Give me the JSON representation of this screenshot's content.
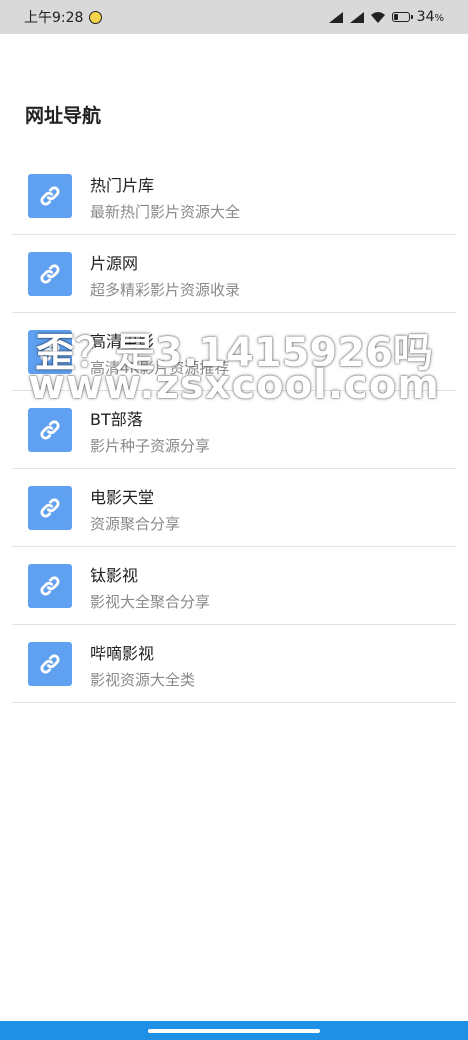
{
  "status_bar": {
    "time": "上午9:28",
    "battery": "34",
    "battery_unit": "%",
    "battery_level": 0.34
  },
  "page": {
    "title": "网址导航"
  },
  "items": [
    {
      "title": "热门片库",
      "desc": "最新热门影片资源大全",
      "icon": "link-icon"
    },
    {
      "title": "片源网",
      "desc": "超多精彩影片资源收录",
      "icon": "link-icon"
    },
    {
      "title": "高清电影",
      "desc": "高清4K影片资源推荐",
      "icon": "link-icon"
    },
    {
      "title": "BT部落",
      "desc": "影片种子资源分享",
      "icon": "link-icon"
    },
    {
      "title": "电影天堂",
      "desc": "资源聚合分享",
      "icon": "link-icon"
    },
    {
      "title": "钛影视",
      "desc": "影视大全聚合分享",
      "icon": "link-icon"
    },
    {
      "title": "哔嘀影视",
      "desc": "影视资源大全类",
      "icon": "link-icon"
    }
  ],
  "watermark": {
    "line1": "歪？是3.1415926吗",
    "line2": "www.zsxcool.com"
  },
  "colors": {
    "accent": "#5fa0f0",
    "nav_bar": "#1e90e6",
    "status_bar": "#d9d9d9"
  }
}
